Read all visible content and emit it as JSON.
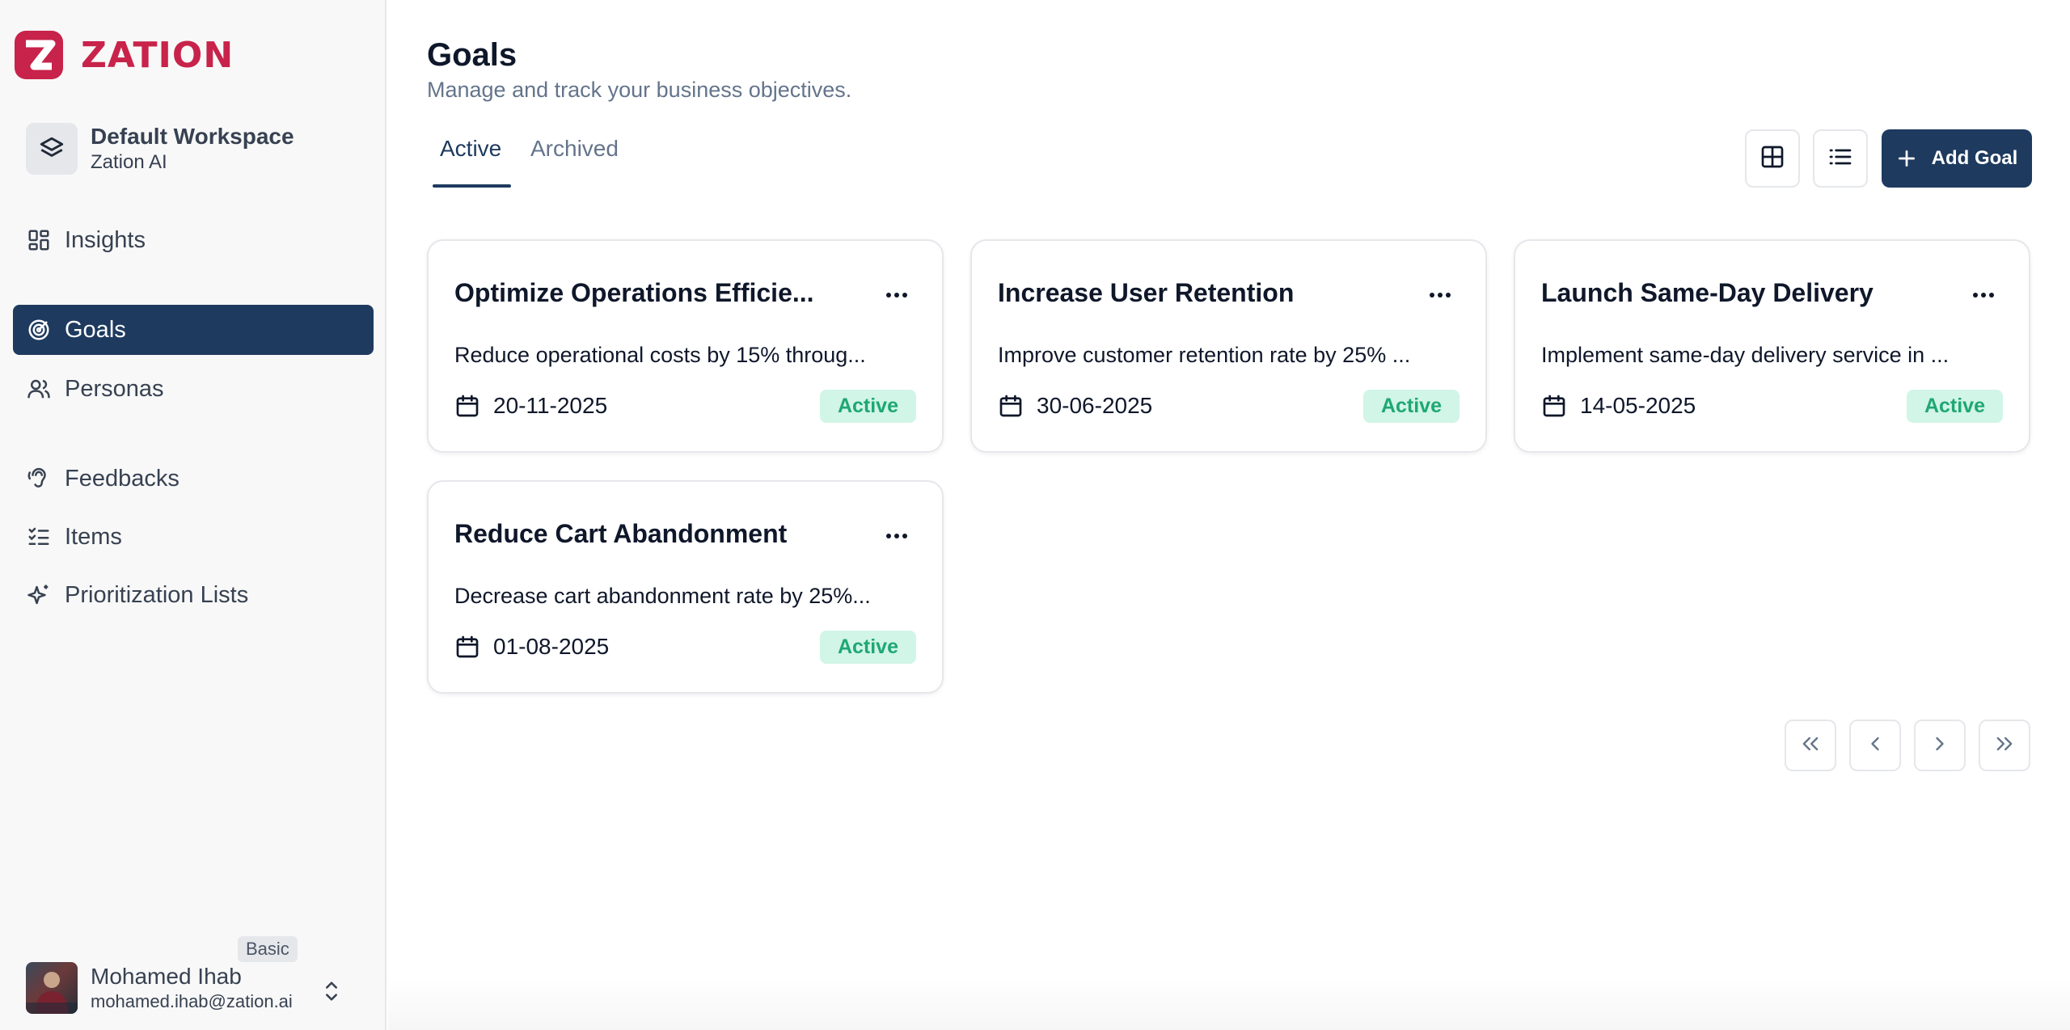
{
  "app": {
    "name": "ZATION",
    "brand_color": "#c8234a",
    "accent_color": "#1e3a5f"
  },
  "workspace": {
    "name": "Default Workspace",
    "org": "Zation AI",
    "icon": "layers-icon"
  },
  "sidebar": {
    "items": [
      {
        "label": "Insights",
        "icon": "dashboard-icon"
      },
      {
        "label": "Goals",
        "icon": "target-icon",
        "active": true
      },
      {
        "label": "Personas",
        "icon": "users-icon"
      },
      {
        "label": "Feedbacks",
        "icon": "ear-icon"
      },
      {
        "label": "Items",
        "icon": "list-checks-icon"
      },
      {
        "label": "Prioritization Lists",
        "icon": "sparkles-icon"
      }
    ]
  },
  "user": {
    "name": "Mohamed Ihab",
    "email": "mohamed.ihab@zation.ai",
    "plan": "Basic"
  },
  "page": {
    "title": "Goals",
    "subtitle": "Manage and track your business objectives."
  },
  "tabs": [
    {
      "label": "Active",
      "active": true
    },
    {
      "label": "Archived",
      "active": false
    }
  ],
  "toolbar": {
    "grid_view_icon": "grid-icon",
    "list_view_icon": "list-icon",
    "add_label": "Add Goal"
  },
  "goals": [
    {
      "title": "Optimize Operations Efficie...",
      "description": "Reduce operational costs by 15% throug...",
      "date": "20-11-2025",
      "status": "Active"
    },
    {
      "title": "Increase User Retention",
      "description": "Improve customer retention rate by 25% ...",
      "date": "30-06-2025",
      "status": "Active"
    },
    {
      "title": "Launch Same-Day Delivery",
      "description": "Implement same-day delivery service in ...",
      "date": "14-05-2025",
      "status": "Active"
    },
    {
      "title": "Reduce Cart Abandonment",
      "description": "Decrease cart abandonment rate by 25%...",
      "date": "01-08-2025",
      "status": "Active"
    }
  ],
  "pagination": {
    "first_icon": "chevrons-left-icon",
    "prev_icon": "chevron-left-icon",
    "next_icon": "chevron-right-icon",
    "last_icon": "chevrons-right-icon"
  }
}
